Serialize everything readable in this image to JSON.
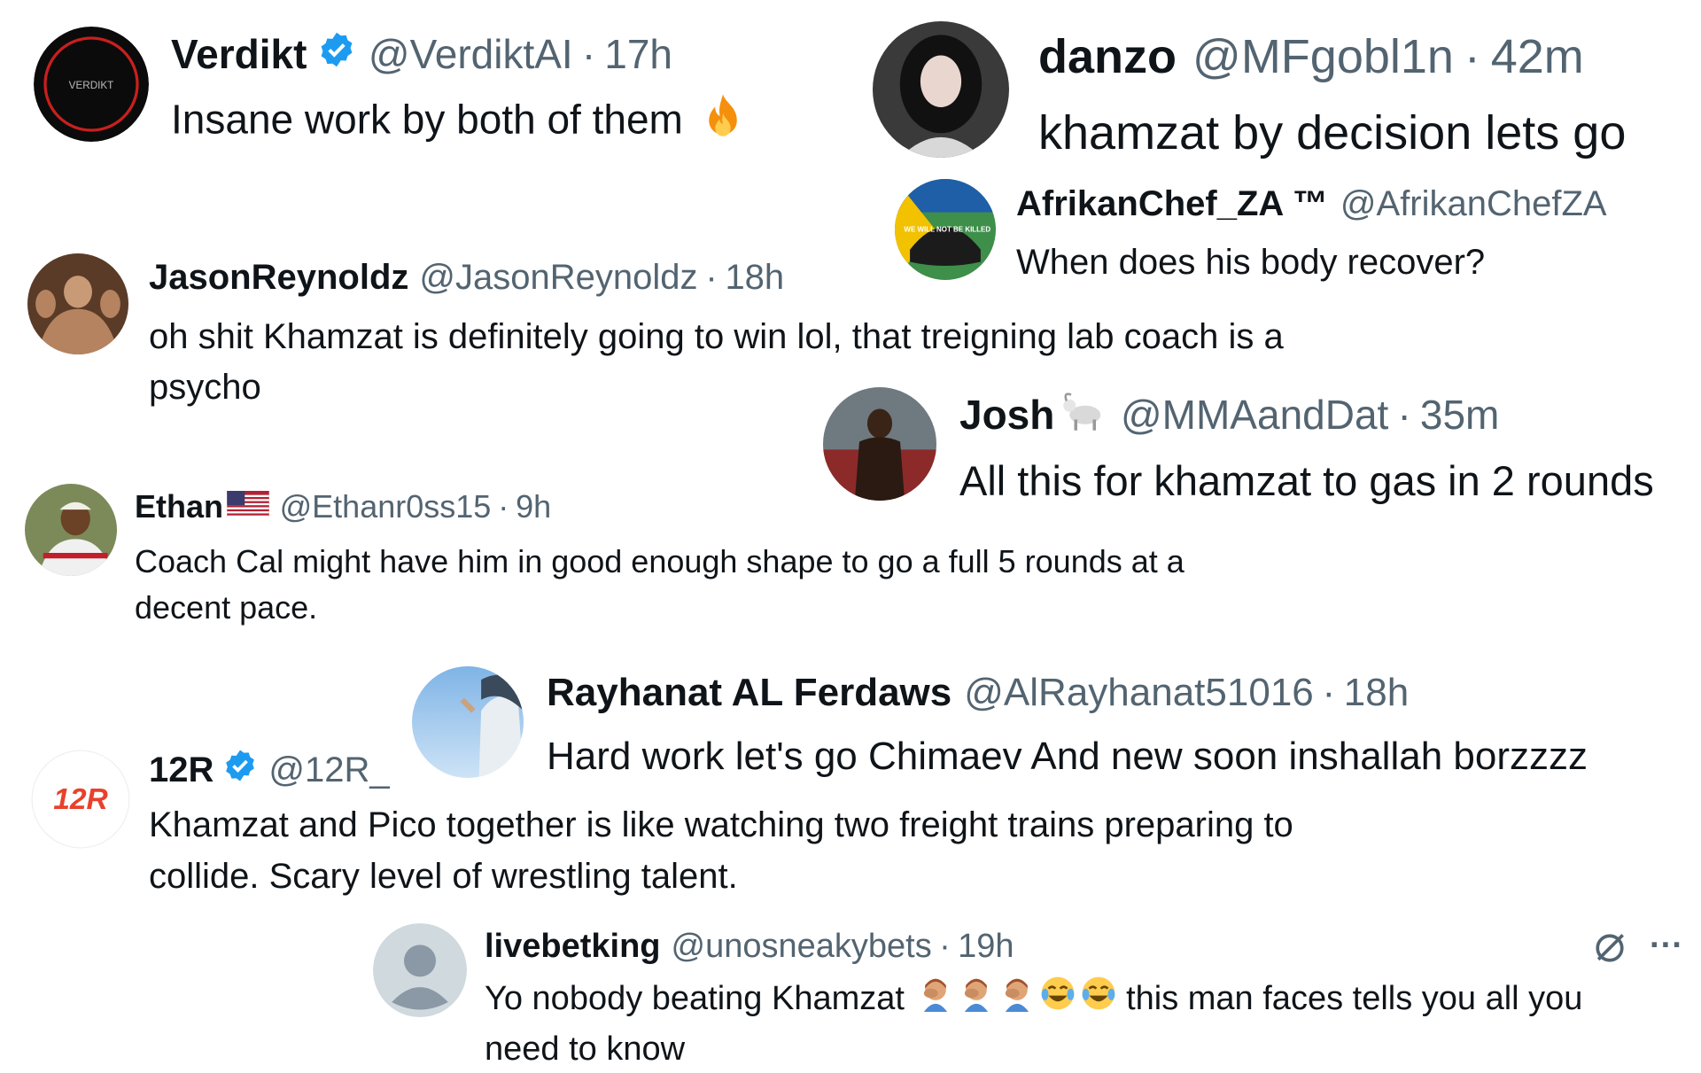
{
  "tweets": {
    "verdikt": {
      "name": "Verdikt",
      "handle": "@VerdiktAI",
      "time": "17h",
      "text": "Insane work by both of them",
      "avatar_text": "VERDIKT",
      "verified": true,
      "emoji_icon": "fire-icon"
    },
    "danzo": {
      "name": "danzo",
      "handle": "@MFgobl1n",
      "time": "42m",
      "text": "khamzat by decision lets go"
    },
    "afrikan": {
      "name": "AfrikanChef_ZA ™",
      "handle": "@AfrikanChefZA",
      "text": "When does his body recover?",
      "avatar_text": "WE WILL NOT BE KILLED"
    },
    "jason": {
      "name": "JasonReynoldz",
      "handle": "@JasonReynoldz",
      "time": "18h",
      "text_line1": "oh shit Khamzat is definitely going to win lol, that treigning lab coach is a",
      "text_line2": "psycho"
    },
    "josh": {
      "name": "Josh",
      "handle": "@MMAandDat",
      "time": "35m",
      "text": "All this for khamzat to gas in 2 rounds",
      "name_emoji_icon": "goat-icon"
    },
    "ethan": {
      "name": "Ethan",
      "handle": "@Ethanr0ss15",
      "time": "9h",
      "text_line1": "Coach Cal might have him in good enough shape to go a full 5 rounds at a",
      "text_line2": "decent pace.",
      "name_emoji_icon": "us-flag-icon"
    },
    "rayhanat": {
      "name": "Rayhanat AL Ferdaws",
      "handle": "@AlRayhanat51016",
      "time": "18h",
      "text": "Hard work let's go Chimaev And new soon inshallah borzzzz"
    },
    "r12": {
      "name": "12R",
      "handle": "@12R_",
      "text_line1": "Khamzat and Pico together is like watching two freight trains preparing to",
      "text_line2": "collide. Scary level of wrestling talent.",
      "avatar_text": "12R",
      "verified": true
    },
    "livebet": {
      "name": "livebetking",
      "handle": "@unosneakybets",
      "time": "19h",
      "text_before": "Yo nobody beating Khamzat",
      "text_after": "this man faces tells you all you",
      "text_line2": "need to know",
      "emoji_icons": [
        "facepalm-icon",
        "facepalm-icon",
        "facepalm-icon",
        "tears-of-joy-icon",
        "tears-of-joy-icon"
      ],
      "more_label": "···"
    }
  },
  "colors": {
    "verified": "#1d9bf0",
    "secondary_text": "#536471",
    "primary_text": "#0f1419",
    "brand_12r": "#e8412c"
  }
}
